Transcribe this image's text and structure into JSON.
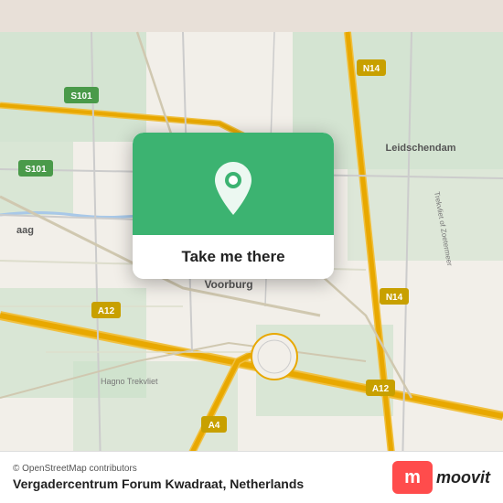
{
  "map": {
    "attribution": "© OpenStreetMap contributors"
  },
  "card": {
    "button_label": "Take me there",
    "pin_icon": "location-pin"
  },
  "footer": {
    "location_name": "Vergadercentrum Forum Kwadraat, Netherlands",
    "moovit_label": "moovit"
  },
  "colors": {
    "green": "#3cb371",
    "red": "#ff4c4c",
    "white": "#ffffff"
  }
}
